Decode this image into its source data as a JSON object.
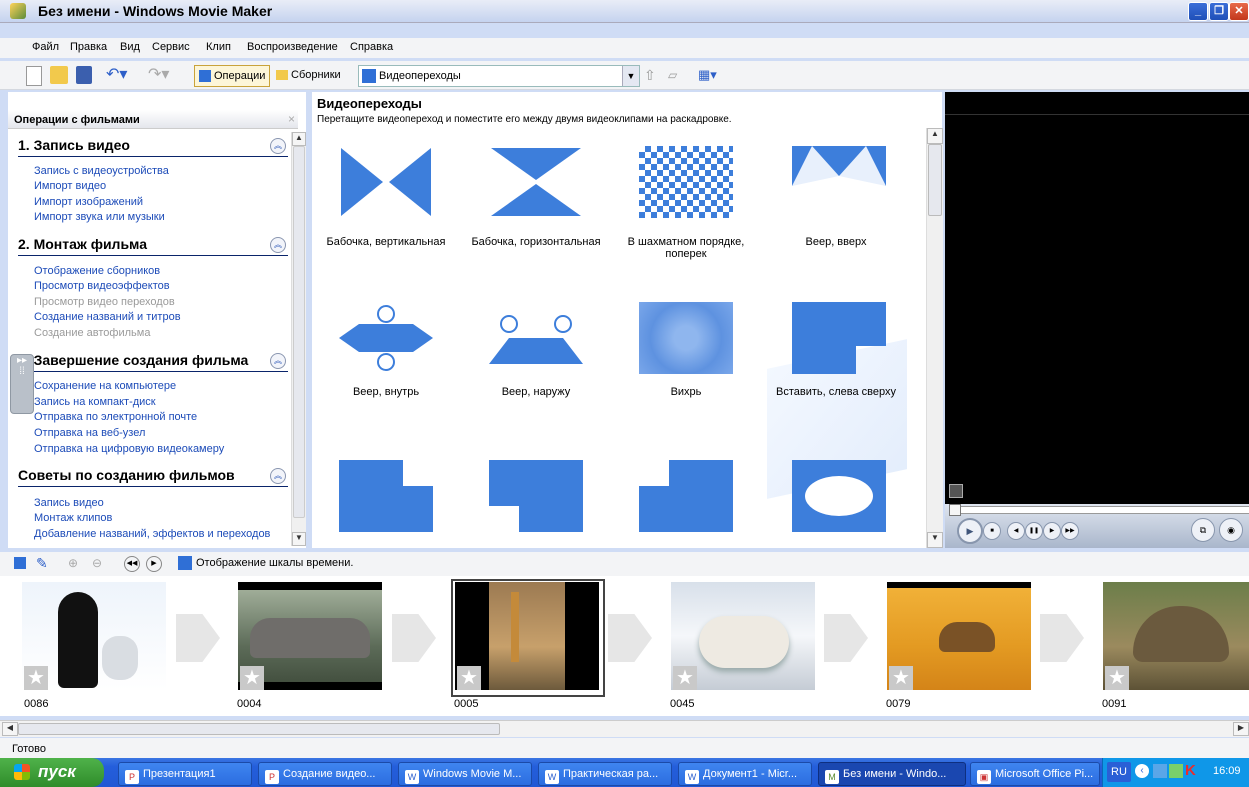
{
  "window": {
    "title": "Без имени - Windows Movie Maker"
  },
  "menu": [
    "Файл",
    "Правка",
    "Вид",
    "Сервис",
    "Клип",
    "Воспроизведение",
    "Справка"
  ],
  "toolbar": {
    "tasks_label": "Операции",
    "collections_label": "Сборники",
    "collection_select": "Видеопереходы"
  },
  "left": {
    "pane_title": "Операции с фильмами",
    "sections": [
      {
        "title": "1. Запись видео",
        "links": [
          {
            "label": "Запись с видеоустройства",
            "enabled": true
          },
          {
            "label": "Импорт видео",
            "enabled": true
          },
          {
            "label": "Импорт изображений",
            "enabled": true
          },
          {
            "label": "Импорт звука или музыки",
            "enabled": true
          }
        ]
      },
      {
        "title": "2. Монтаж фильма",
        "links": [
          {
            "label": "Отображение сборников",
            "enabled": true
          },
          {
            "label": "Просмотр видеоэффектов",
            "enabled": true
          },
          {
            "label": "Просмотр видео переходов",
            "enabled": false
          },
          {
            "label": "Создание названий и титров",
            "enabled": true
          },
          {
            "label": "Создание автофильма",
            "enabled": false
          }
        ]
      },
      {
        "title": "3. Завершение создания фильма",
        "links": [
          {
            "label": "Сохранение на компьютере",
            "enabled": true
          },
          {
            "label": "Запись на компакт-диск",
            "enabled": true
          },
          {
            "label": "Отправка по электронной почте",
            "enabled": true
          },
          {
            "label": "Отправка на веб-узел",
            "enabled": true
          },
          {
            "label": "Отправка на цифровую видеокамеру",
            "enabled": true
          }
        ]
      },
      {
        "title": "Советы по созданию фильмов",
        "links": [
          {
            "label": "Запись видео",
            "enabled": true
          },
          {
            "label": "Монтаж клипов",
            "enabled": true
          },
          {
            "label": "Добавление названий, эффектов и переходов",
            "enabled": true
          }
        ]
      }
    ]
  },
  "center": {
    "title": "Видеопереходы",
    "subtitle": "Перетащите видеопереход и поместите его между двумя видеоклипами на раскадровке.",
    "transitions": [
      {
        "name": "Бабочка, вертикальная",
        "icon": "butterfly-vertical-icon"
      },
      {
        "name": "Бабочка, горизонтальная",
        "icon": "butterfly-horizontal-icon"
      },
      {
        "name": "В шахматном порядке, поперек",
        "icon": "checkerboard-icon"
      },
      {
        "name": "Веер, вверх",
        "icon": "fan-up-icon"
      },
      {
        "name": "Веер, внутрь",
        "icon": "fan-in-icon"
      },
      {
        "name": "Веер, наружу",
        "icon": "fan-out-icon"
      },
      {
        "name": "Вихрь",
        "icon": "whirlwind-icon"
      },
      {
        "name": "Вставить, слева сверху",
        "icon": "inset-top-left-icon"
      },
      {
        "name": "",
        "icon": "inset-top-right-icon"
      },
      {
        "name": "",
        "icon": "inset-bottom-left-icon"
      },
      {
        "name": "",
        "icon": "inset-tl-arrow-icon"
      },
      {
        "name": "",
        "icon": "iris-eye-icon"
      }
    ]
  },
  "storyboard": {
    "timeline_label": "Отображение шкалы времени.",
    "clips": [
      {
        "name": "0086",
        "icon": "penguins-image"
      },
      {
        "name": "0004",
        "icon": "elephants-image"
      },
      {
        "name": "0005",
        "icon": "giraffes-image"
      },
      {
        "name": "0045",
        "icon": "seal-image"
      },
      {
        "name": "0079",
        "icon": "camel-image"
      },
      {
        "name": "0091",
        "icon": "tortoise-image"
      }
    ]
  },
  "status": "Готово",
  "taskbar": {
    "start": "пуск",
    "tasks": [
      "Презентация1",
      "Создание видео...",
      "Windows Movie M...",
      "Практическая ра...",
      "Документ1 - Micr...",
      "Без имени - Windo...",
      "Microsoft Office Pi..."
    ],
    "lang": "RU",
    "time": "16:09"
  },
  "colors": {
    "accent": "#3d7edb",
    "link": "#1c4bb8",
    "taskbar": "#245edb",
    "start": "#3a9c35"
  }
}
